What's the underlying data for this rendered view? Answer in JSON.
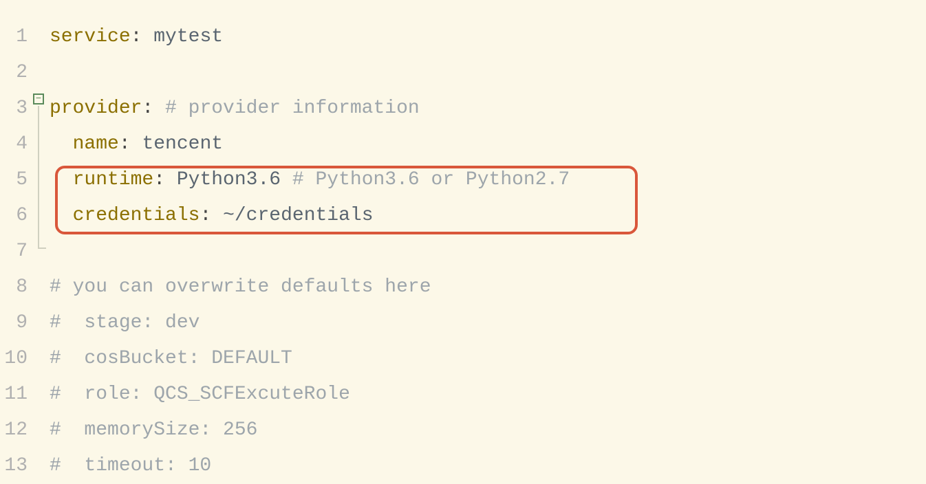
{
  "lines": {
    "n1": "1",
    "n2": "2",
    "n3": "3",
    "n4": "4",
    "n5": "5",
    "n6": "6",
    "n7": "7",
    "n8": "8",
    "n9": "9",
    "n10": "10",
    "n11": "11",
    "n12": "12",
    "n13": "13"
  },
  "code": {
    "l1": {
      "key": "service",
      "colon": ":",
      "value": " mytest"
    },
    "l3": {
      "key": "provider",
      "colon": ":",
      "comment": " # provider information"
    },
    "l4": {
      "indent": "  ",
      "key": "name",
      "colon": ":",
      "value": " tencent"
    },
    "l5": {
      "indent": "  ",
      "key": "runtime",
      "colon": ":",
      "value": " Python3.6",
      "comment": " # Python3.6 or Python2.7"
    },
    "l6": {
      "indent": "  ",
      "key": "credentials",
      "colon": ":",
      "value": " ~/credentials"
    },
    "l8": {
      "comment": "# you can overwrite defaults here"
    },
    "l9": {
      "comment": "#  stage: dev"
    },
    "l10": {
      "comment": "#  cosBucket: DEFAULT"
    },
    "l11": {
      "comment": "#  role: QCS_SCFExcuteRole"
    },
    "l12": {
      "comment": "#  memorySize: 256"
    },
    "l13": {
      "comment": "#  timeout: 10"
    }
  },
  "fold": {
    "marker": "−"
  }
}
